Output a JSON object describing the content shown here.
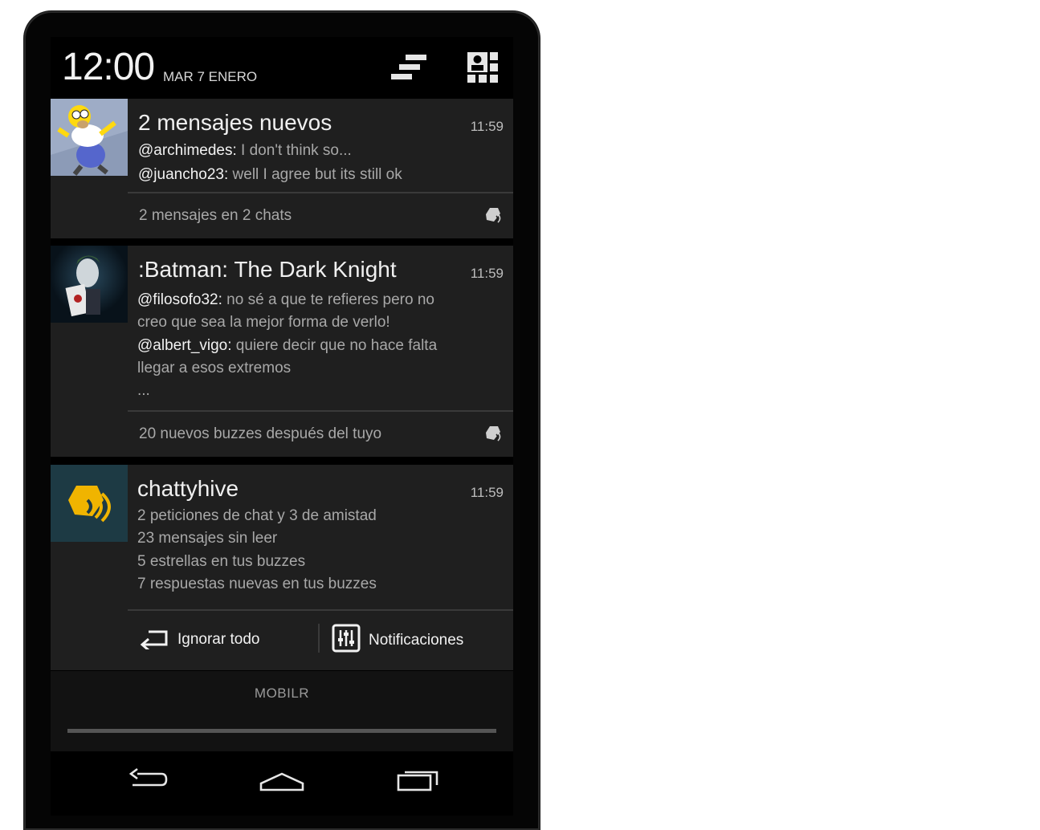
{
  "status_bar": {
    "time": "12:00",
    "date": "MAR 7 ENERO"
  },
  "notifications": [
    {
      "title": "2 mensajes nuevos",
      "time": "11:59",
      "lines": [
        {
          "user": "@archimedes:",
          "text": " I don't think so..."
        },
        {
          "user": "@juancho23:",
          "text": " well I agree but its still ok"
        }
      ],
      "footer": "2 mensajes en 2 chats"
    },
    {
      "title": ":Batman: The Dark Knight",
      "time": "11:59",
      "lines": [
        {
          "user": "@filosofo32:",
          "text": " no sé a que te refieres pero no"
        },
        {
          "user": "",
          "text": "creo que sea la mejor forma de verlo!"
        },
        {
          "user": "@albert_vigo:",
          "text": " quiere decir que no hace falta"
        },
        {
          "user": "",
          "text": "llegar a esos extremos"
        },
        {
          "user": "",
          "text": "..."
        }
      ],
      "footer": "20 nuevos buzzes después del tuyo"
    },
    {
      "title": "chattyhive",
      "time": "11:59",
      "lines": [
        {
          "user": "",
          "text": "2 peticiones de chat y 3 de amistad"
        },
        {
          "user": "",
          "text": "23 mensajes sin leer"
        },
        {
          "user": "",
          "text": "5 estrellas en tus buzzes"
        },
        {
          "user": "",
          "text": "7 respuestas nuevas en tus buzzes"
        }
      ],
      "actions": {
        "dismiss_label": "Ignorar todo",
        "settings_label": "Notificaciones"
      }
    }
  ],
  "carrier": "MOBILR",
  "icons": {
    "sort": "sort-bars-icon",
    "quick_settings": "quick-settings-icon",
    "app_badge": "chattyhive-icon",
    "nav_back": "back-icon",
    "nav_home": "home-icon",
    "nav_recents": "recents-icon"
  },
  "colors": {
    "brand_yellow": "#f0b400",
    "brand_teal": "#1d3a44",
    "card_bg": "#1f1f1f"
  }
}
